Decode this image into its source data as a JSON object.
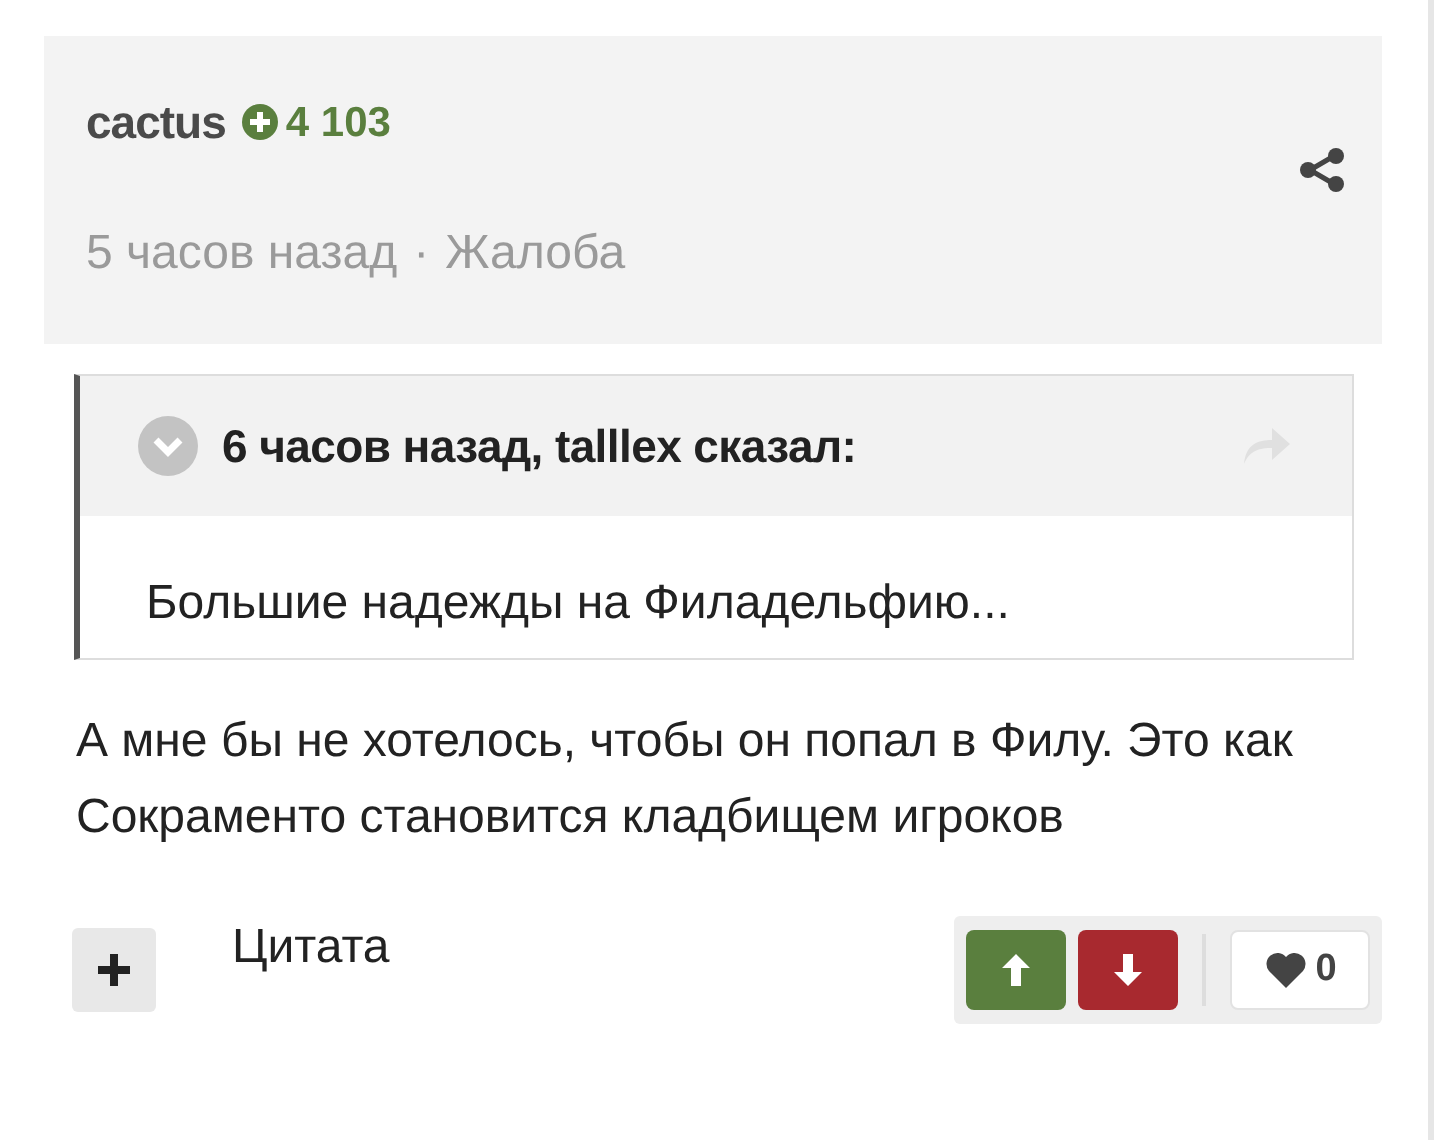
{
  "author": {
    "name": "cactus",
    "reputation": "4 103"
  },
  "meta": {
    "time": "5 часов назад",
    "separator": "·",
    "report": "Жалоба"
  },
  "quote": {
    "header": "6 часов назад, talllex сказал:",
    "text": "Большие надежды на Филадельфию..."
  },
  "post_text": "А мне бы не хотелось, чтобы он попал в Филу. Это как Сокраменто становится кладбищем игроков",
  "footer": {
    "quote_label": "Цитата",
    "likes": "0"
  }
}
